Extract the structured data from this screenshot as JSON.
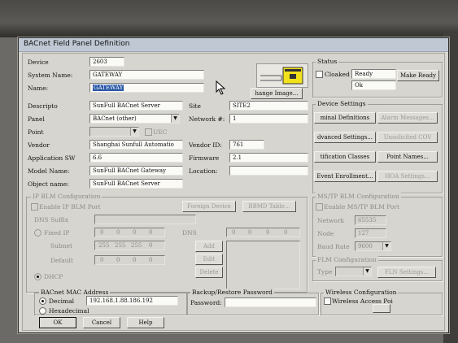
{
  "window": {
    "title": "BACnet Field Panel Definition"
  },
  "fields": {
    "device_label": "Device",
    "device_value": "2603",
    "system_name_label": "System Name:",
    "system_name_value": "GATEWAY",
    "name_label": "Name:",
    "name_value": "GATEWAY",
    "description_label": "Descripto",
    "description_value": "SunFull BACnet Server",
    "panel_label": "Panel",
    "panel_value": "BACnet (other)",
    "point_label": "Point",
    "point_value": "",
    "uec_label": "UEC",
    "vendor_label": "Vendor",
    "vendor_value": "Shanghai Sunfull Automatio",
    "app_sw_label": "Application SW",
    "app_sw_value": "6.6",
    "model_label": "Model Name:",
    "model_value": "SunFull BACnet Gateway",
    "object_name_label": "Object name:",
    "object_name_value": "SunFull BACnet Server",
    "site_label": "Site",
    "site_value": "SITE2",
    "network_label": "Network #:",
    "network_value": "1",
    "vendor_id_label": "Vendor ID:",
    "vendor_id_value": "761",
    "firmware_label": "Firmware",
    "firmware_value": "2.1",
    "location_label": "Location:",
    "location_value": ""
  },
  "change_image_button": "hange Image...",
  "status": {
    "title": "Status",
    "cloaked_label": "Cloaked",
    "state_value": "Ready",
    "ok_value": "Ok",
    "make_ready_button": "Make Ready"
  },
  "device_settings": {
    "title": "Device Settings",
    "buttons": [
      "minal Definitions",
      "Alarm Messages...",
      "dvanced Settings...",
      "Unsolicited COV",
      "tification Classes",
      "Point Names...",
      "Event Enrollment...",
      "HOA Settings..."
    ]
  },
  "ip_blm": {
    "title": "IP BLM Configuration",
    "enable_label": "Enable IP BLM Port",
    "foreign_device_button": "Foreign Device",
    "bbmd_table_button": "BBMD Table...",
    "dns_suffix_label": "DNS Suffix",
    "fixed_ip_label": "Fixed IP",
    "subnet_label": "Subnet",
    "default_label": "Default",
    "dns_label": "DNS",
    "dhcp_label": "DHCP",
    "ip_octets": [
      "0",
      "0",
      "0",
      "0"
    ],
    "subnet_octets": [
      "255",
      "255",
      "255",
      "0"
    ],
    "default_octets": [
      "0",
      "0",
      "0",
      "0"
    ],
    "dns_octets": [
      "0",
      "0",
      "0",
      "0"
    ],
    "add_button": "Add",
    "edit_button": "Edit",
    "delete_button": "Delete"
  },
  "mstp_blm": {
    "title": "MS/TP BLM Configuration",
    "enable_label": "Enable MS/TP BLM Port",
    "network_label": "Network",
    "network_value": "65535",
    "node_label": "Node",
    "node_value": "127",
    "baud_label": "Baud Rate",
    "baud_value": "9600"
  },
  "flm": {
    "title": "FLM Configuration",
    "type_label": "Type",
    "settings_button": "FLN Settings..."
  },
  "mac": {
    "title": "BACnet MAC Address",
    "decimal_label": "Decimal",
    "decimal_value": "192.168.1.88.186.192",
    "hex_label": "Hexadecimal"
  },
  "backup": {
    "title": "Backup/Restore Password",
    "password_label": "Password:"
  },
  "wireless": {
    "title": "Wireless Configuration",
    "access_label": "Wireless Access Poi"
  },
  "footer": {
    "ok": "OK",
    "cancel": "Cancel",
    "help": "Help"
  },
  "colors": {
    "title_bg": "#bfc8d3",
    "dialog_bg": "#d7d5cf",
    "selection": "#2956a6",
    "logo_yellow": "#f2e21b"
  }
}
